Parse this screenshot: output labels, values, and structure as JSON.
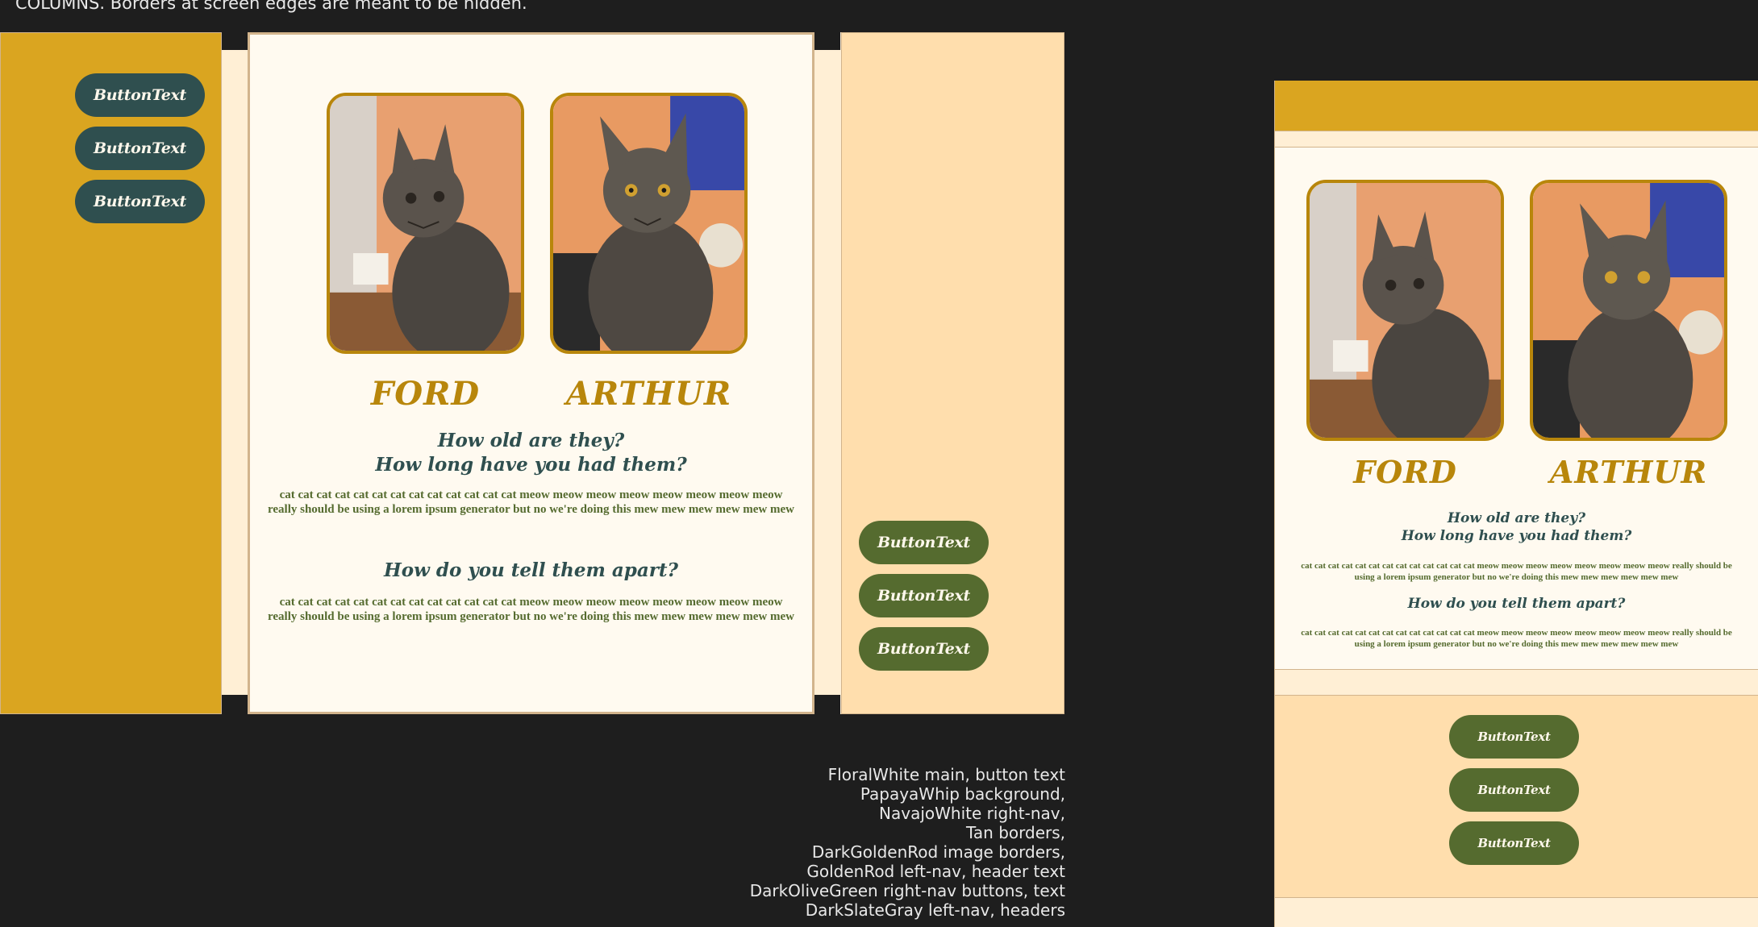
{
  "note": {
    "top": "COLUMNS. Borders at screen edges are meant to be hidden."
  },
  "left_nav": {
    "buttons": [
      "ButtonText",
      "ButtonText",
      "ButtonText"
    ]
  },
  "right_nav": {
    "buttons": [
      "ButtonText",
      "ButtonText",
      "ButtonText"
    ]
  },
  "main": {
    "cats": [
      {
        "name": "FORD",
        "photo_icon": "tabby-cat-photo"
      },
      {
        "name": "ARTHUR",
        "photo_icon": "tabby-cat-photo"
      }
    ],
    "question1_line1": "How old are they?",
    "question1_line2": "How long have you had them?",
    "paragraph1": "cat cat cat cat cat cat cat cat cat cat cat cat cat meow meow meow meow meow meow meow meow really should be using a lorem ipsum generator but no we're doing this mew mew mew mew mew mew",
    "question2": "How do you tell them apart?",
    "paragraph2": "cat cat cat cat cat cat cat cat cat cat cat cat cat meow meow meow meow meow meow meow meow really should be using a lorem ipsum generator but no we're doing this mew mew mew mew mew mew"
  },
  "mobile_right_nav": {
    "buttons": [
      "ButtonText",
      "ButtonText",
      "ButtonText"
    ]
  },
  "legend": [
    "FloralWhite main, button text",
    "PapayaWhip background,",
    "NavajoWhite right-nav,",
    "Tan borders,",
    "DarkGoldenRod image borders,",
    "GoldenRod left-nav, header text",
    "DarkOliveGreen right-nav buttons, text",
    "DarkSlateGray left-nav, headers"
  ],
  "colors": {
    "floral_white": "#fffaf0",
    "papaya_whip": "#ffefd5",
    "navajo_white": "#ffdead",
    "tan": "#d2b48c",
    "dark_golden_rod": "#b8860b",
    "golden_rod": "#daa520",
    "dark_olive_green": "#556b2f",
    "dark_slate_gray": "#2f4f4f"
  }
}
